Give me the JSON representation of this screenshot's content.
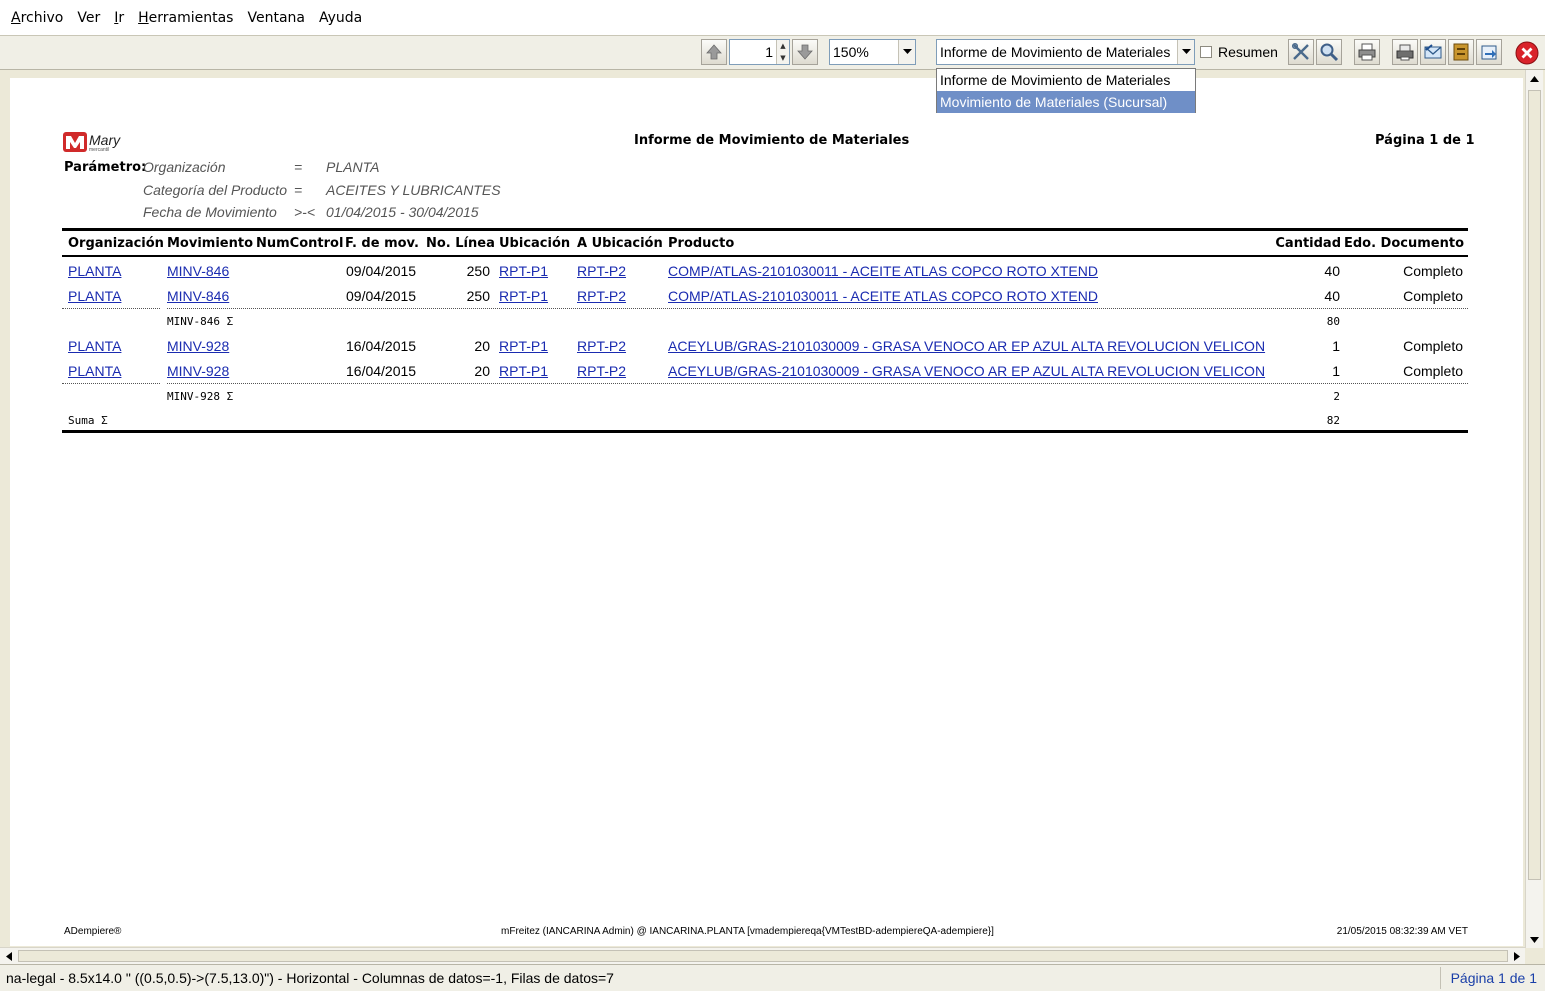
{
  "menu": [
    {
      "label": "Archivo",
      "u": "A",
      "rest": "rchivo"
    },
    {
      "label": "Ver",
      "u": "",
      "rest": "Ver"
    },
    {
      "label": "Ir",
      "u": "I",
      "rest": "r"
    },
    {
      "label": "Herramientas",
      "u": "H",
      "rest": "erramientas"
    },
    {
      "label": "Ventana",
      "u": "",
      "rest": "Ventana"
    },
    {
      "label": "Ayuda",
      "u": "",
      "rest": "Ayuda"
    }
  ],
  "toolbar": {
    "page_value": "1",
    "zoom_value": "150%",
    "report_selected": "Informe de Movimiento de Materiales",
    "resumen_label": "Resumen",
    "resumen_checked": false
  },
  "report_options": [
    {
      "label": "Informe de Movimiento de Materiales",
      "selected": false
    },
    {
      "label": "Movimiento de Materiales (Sucursal)",
      "selected": true
    }
  ],
  "report": {
    "logo_text": "Mary",
    "logo_sub": "mercantil",
    "title": "Informe de Movimiento de Materiales",
    "page": "Página 1 de 1",
    "param_label": "Parámetro:",
    "params": [
      {
        "name": "Organización",
        "op": "=",
        "value": "PLANTA"
      },
      {
        "name": "Categoría del Producto",
        "op": "=",
        "value": "ACEITES Y LUBRICANTES"
      },
      {
        "name": "Fecha de Movimiento",
        "op": ">-<",
        "value": "01/04/2015 - 30/04/2015"
      }
    ],
    "columns": {
      "org": "Organización",
      "mov": "Movimiento",
      "num": "NumControl",
      "fecha": "F. de mov.",
      "linea": "No. Línea",
      "ubic": "Ubicación",
      "aubic": "A Ubicación",
      "prod": "Producto",
      "cant": "Cantidad",
      "edo": "Edo. Documento"
    },
    "rows": [
      {
        "org": "PLANTA",
        "mov": "MINV-846",
        "fecha": "09/04/2015",
        "linea": "250",
        "ubic": "RPT-P1",
        "aubic": "RPT-P2",
        "prod": "COMP/ATLAS-2101030011 - ACEITE ATLAS COPCO ROTO XTEND",
        "cant": "40",
        "edo": "Completo"
      },
      {
        "org": "PLANTA",
        "mov": "MINV-846",
        "fecha": "09/04/2015",
        "linea": "250",
        "ubic": "RPT-P1",
        "aubic": "RPT-P2",
        "prod": "COMP/ATLAS-2101030011 - ACEITE ATLAS COPCO ROTO XTEND",
        "cant": "40",
        "edo": "Completo"
      },
      {
        "org": "PLANTA",
        "mov": "MINV-928",
        "fecha": "16/04/2015",
        "linea": "20",
        "ubic": "RPT-P1",
        "aubic": "RPT-P2",
        "prod": "ACEYLUB/GRAS-2101030009 - GRASA VENOCO AR EP AZUL ALTA REVOLUCION VELICON",
        "cant": "1",
        "edo": "Completo"
      },
      {
        "org": "PLANTA",
        "mov": "MINV-928",
        "fecha": "16/04/2015",
        "linea": "20",
        "ubic": "RPT-P1",
        "aubic": "RPT-P2",
        "prod": "ACEYLUB/GRAS-2101030009 - GRASA VENOCO AR EP AZUL ALTA REVOLUCION VELICON",
        "cant": "1",
        "edo": "Completo"
      }
    ],
    "subtotals": [
      {
        "label": "MINV-846 Σ",
        "value": "80"
      },
      {
        "label": "MINV-928 Σ",
        "value": "2"
      }
    ],
    "total": {
      "label": "Suma Σ",
      "value": "82"
    },
    "footer_left": "ADempiere®",
    "footer_center": "mFreitez (IANCARINA Admin) @ IANCARINA.PLANTA [vmadempiereqa{VMTestBD-adempiereQA-adempiere}]",
    "footer_right": "21/05/2015 08:32:39 AM VET"
  },
  "status": {
    "text": "na-legal - 8.5x14.0 \" ((0.5,0.5)->(7.5,13.0)\") - Horizontal - Columnas de datos=-1, Filas de datos=7",
    "page": "Página 1 de 1"
  },
  "colors": {
    "link": "#1a2bb0",
    "selection": "#6f8fc7",
    "close": "#d9232a"
  }
}
